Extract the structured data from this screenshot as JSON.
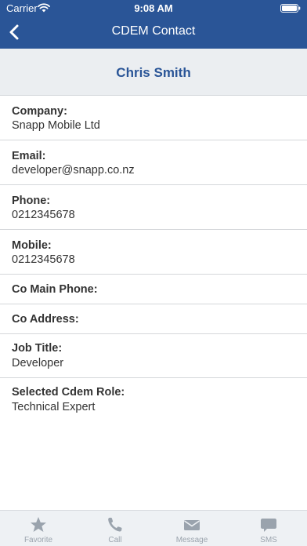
{
  "status_bar": {
    "carrier": "Carrier",
    "time": "9:08 AM"
  },
  "nav": {
    "title": "CDEM Contact"
  },
  "contact": {
    "name": "Chris Smith"
  },
  "fields": [
    {
      "label": "Company:",
      "value": "Snapp Mobile Ltd"
    },
    {
      "label": "Email:",
      "value": "developer@snapp.co.nz"
    },
    {
      "label": "Phone:",
      "value": "0212345678"
    },
    {
      "label": "Mobile:",
      "value": "0212345678"
    },
    {
      "label": "Co Main Phone:",
      "value": ""
    },
    {
      "label": "Co Address:",
      "value": ""
    },
    {
      "label": "Job Title:",
      "value": "Developer"
    },
    {
      "label": "Selected Cdem Role:",
      "value": "Technical Expert"
    }
  ],
  "tabs": [
    {
      "label": "Favorite",
      "icon": "star-icon"
    },
    {
      "label": "Call",
      "icon": "phone-icon"
    },
    {
      "label": "Message",
      "icon": "envelope-icon"
    },
    {
      "label": "SMS",
      "icon": "chat-bubble-icon"
    }
  ],
  "colors": {
    "brand": "#2a5597",
    "header_bg": "#ebeef1",
    "tab_icon": "#9aa3ad"
  }
}
